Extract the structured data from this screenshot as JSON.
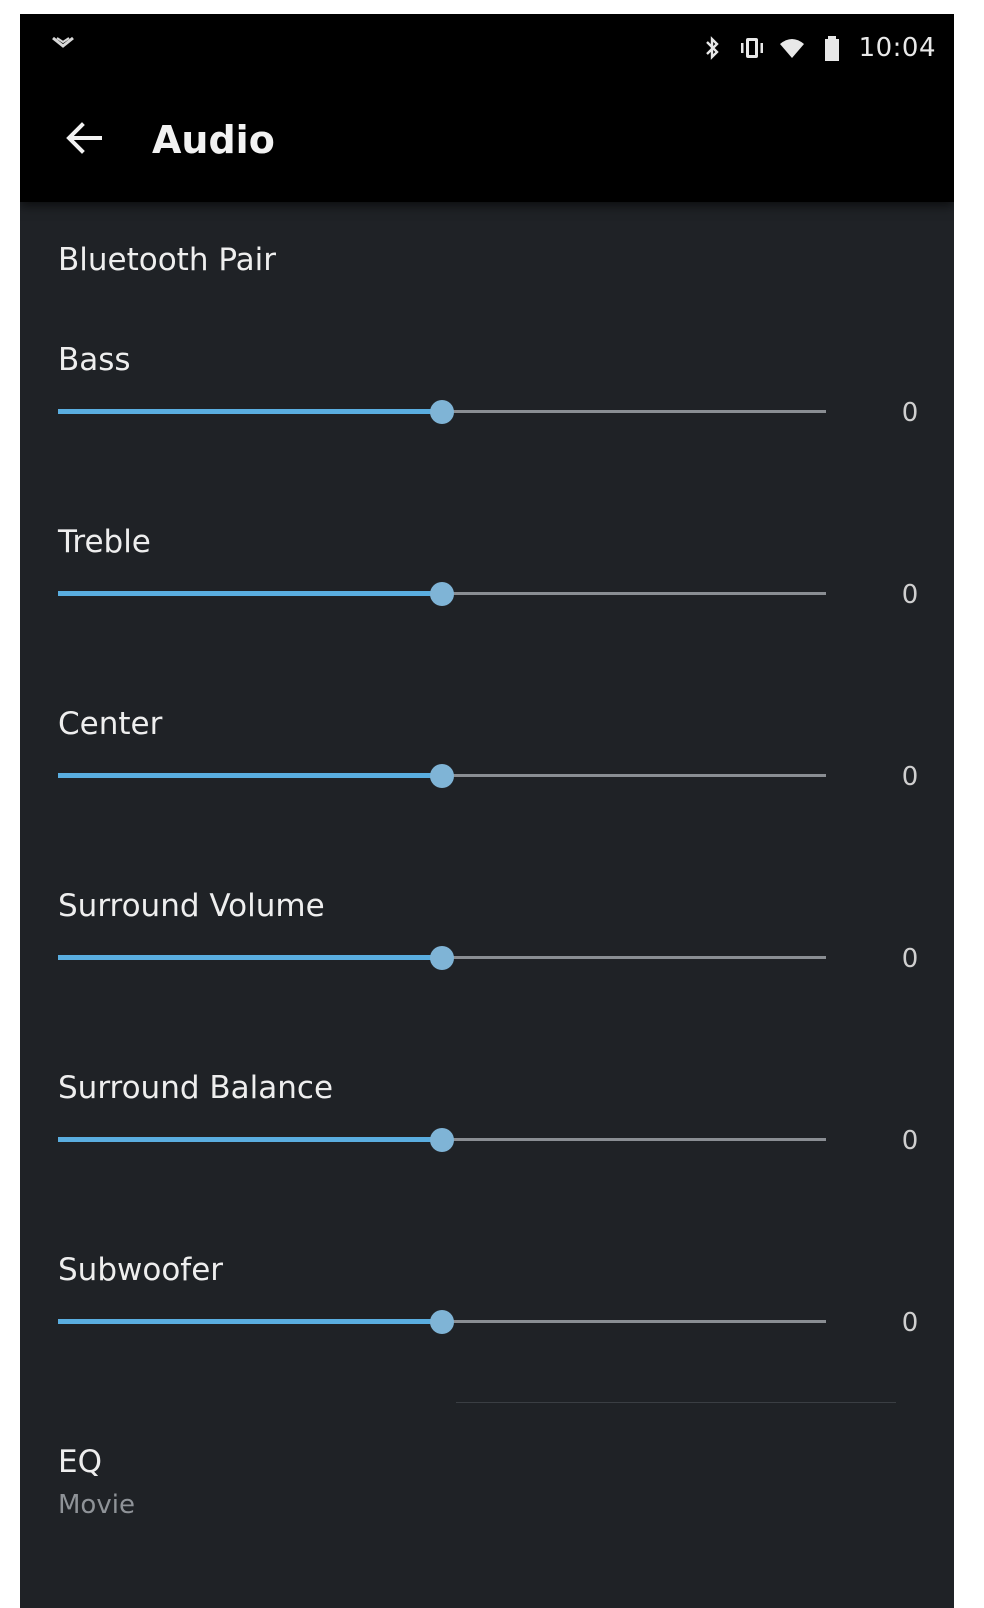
{
  "status_bar": {
    "time": "10:04",
    "left_icon": "download-notification-icon",
    "icons": [
      "bluetooth-icon",
      "vibrate-icon",
      "wifi-icon",
      "battery-icon"
    ]
  },
  "app_bar": {
    "title": "Audio",
    "back_icon": "back-arrow-icon"
  },
  "bluetooth_pair": {
    "label": "Bluetooth Pair"
  },
  "sliders": [
    {
      "label": "Bass",
      "value": "0",
      "position": 0.5
    },
    {
      "label": "Treble",
      "value": "0",
      "position": 0.5
    },
    {
      "label": "Center",
      "value": "0",
      "position": 0.5
    },
    {
      "label": "Surround Volume",
      "value": "0",
      "position": 0.5
    },
    {
      "label": "Surround Balance",
      "value": "0",
      "position": 0.5
    },
    {
      "label": "Subwoofer",
      "value": "0",
      "position": 0.5
    }
  ],
  "eq": {
    "title": "EQ",
    "value": "Movie"
  },
  "colors": {
    "background": "#1f2226",
    "bar": "#000000",
    "accent": "#5aaee0",
    "track": "#8a8e93"
  }
}
